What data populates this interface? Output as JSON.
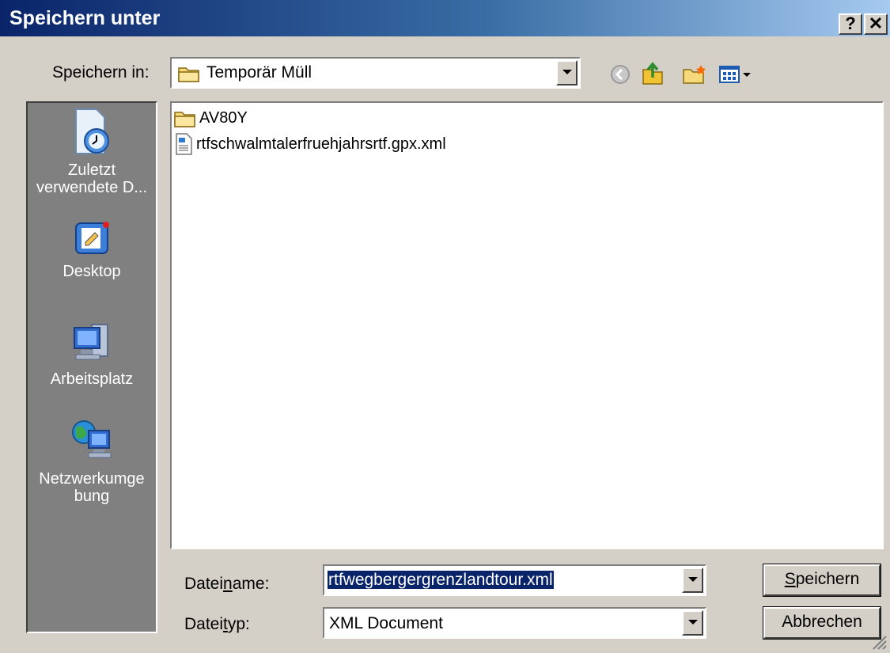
{
  "window": {
    "title": "Speichern unter",
    "help_label": "?",
    "close_label": "✕"
  },
  "toolbar": {
    "save_in_label": "Speichern in:",
    "save_in_value": "Temporär Müll",
    "icons": [
      "back-icon",
      "up-folder-icon",
      "new-folder-icon",
      "view-menu-icon"
    ]
  },
  "places": [
    {
      "label_line1": "Zuletzt",
      "label_line2": "verwendete D...",
      "icon": "recent-documents-icon"
    },
    {
      "label_line1": "Desktop",
      "label_line2": "",
      "icon": "desktop-icon"
    },
    {
      "label_line1": "Arbeitsplatz",
      "label_line2": "",
      "icon": "my-computer-icon"
    },
    {
      "label_line1": "Netzwerkumge",
      "label_line2": "bung",
      "icon": "network-icon"
    }
  ],
  "files": [
    {
      "name": "AV80Y",
      "type": "folder"
    },
    {
      "name": "rtfschwalmtalerfruehjahrsrtf.gpx.xml",
      "type": "xml"
    }
  ],
  "form": {
    "filename_label_a": "Datei",
    "filename_label_u": "n",
    "filename_label_b": "ame:",
    "filename_value": "rtfwegbergergrenzlandtour.xml",
    "filetype_label_a": "Datei",
    "filetype_label_u": "t",
    "filetype_label_b": "yp:",
    "filetype_value": "XML Document"
  },
  "buttons": {
    "save_u": "S",
    "save_rest": "peichern",
    "cancel": "Abbrechen"
  },
  "colors": {
    "titlebar_start": "#0a246a",
    "titlebar_end": "#a6caf0",
    "selection": "#0a246a"
  }
}
